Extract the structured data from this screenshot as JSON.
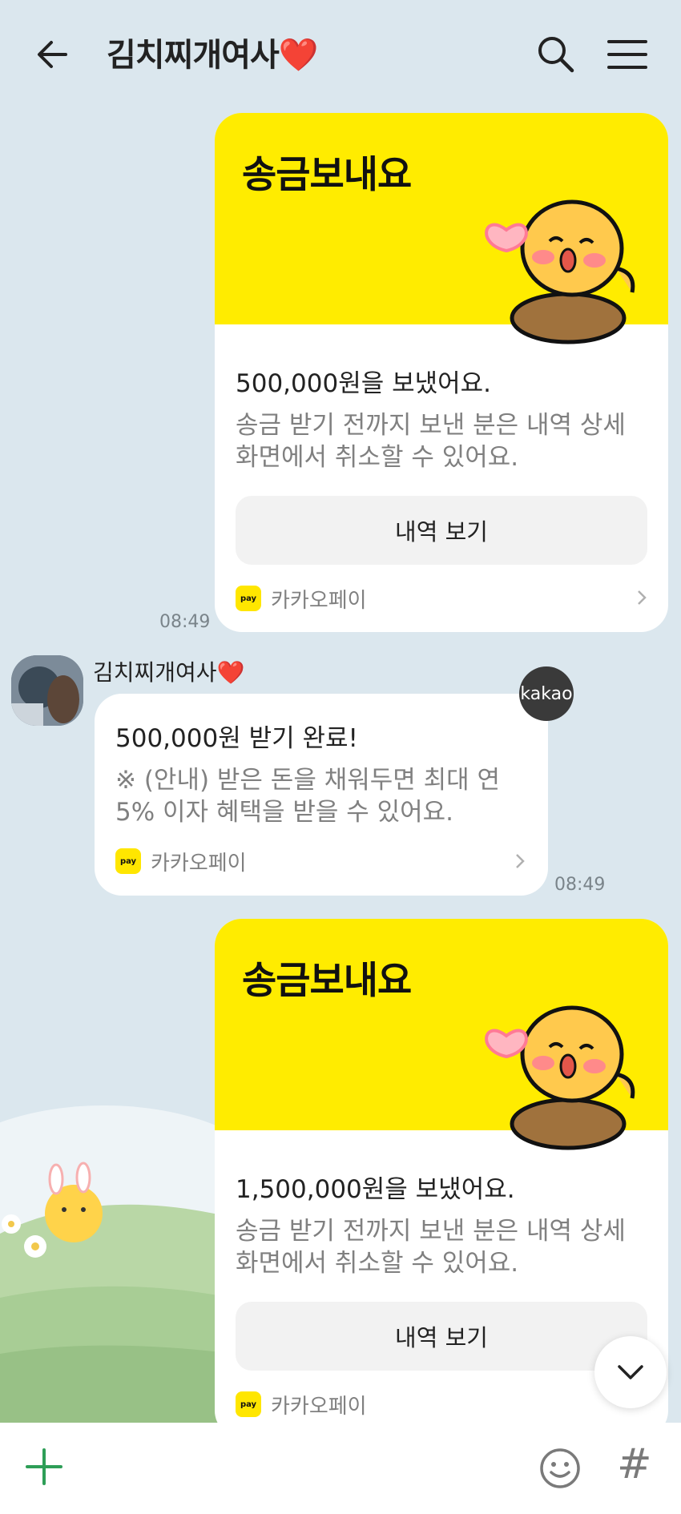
{
  "header": {
    "title": "김치찌개여사",
    "title_emoji": "❤️"
  },
  "messages": [
    {
      "card_title": "송금보내요",
      "amount_text": "500,000원을 보냈어요.",
      "desc_line1": "송금 받기 전까지 보낸 분은 내역 상세",
      "desc_line2": "화면에서 취소할 수 있어요.",
      "button_label": "내역 보기",
      "pay_label": "카카오페이",
      "time": "08:49"
    },
    {
      "sender_name": "김치찌개여사",
      "sender_emoji": "❤️",
      "title": "500,000원 받기 완료!",
      "desc_line1": "※ (안내) 받은 돈을 채워두면 최대 연",
      "desc_line2": "5% 이자 혜택을 받을 수 있어요.",
      "pay_label": "카카오페이",
      "badge": "kakao",
      "time": "08:49"
    },
    {
      "card_title": "송금보내요",
      "amount_text": "1,500,000원을 보냈어요.",
      "desc_line1": "송금 받기 전까지 보낸 분은 내역 상세",
      "desc_line2": "화면에서 취소할 수 있어요.",
      "button_label": "내역 보기",
      "pay_label": "카카오페이"
    }
  ],
  "pay_icon_text": "pay",
  "icons": [
    "back-arrow-icon",
    "search-icon",
    "menu-icon",
    "plus-icon",
    "emoji-icon",
    "hash-icon",
    "chevron-down-icon",
    "chevron-right-icon"
  ],
  "colors": {
    "background": "#dbe7ee",
    "kakao_yellow": "#ffec00",
    "heart": "#e8283b"
  }
}
